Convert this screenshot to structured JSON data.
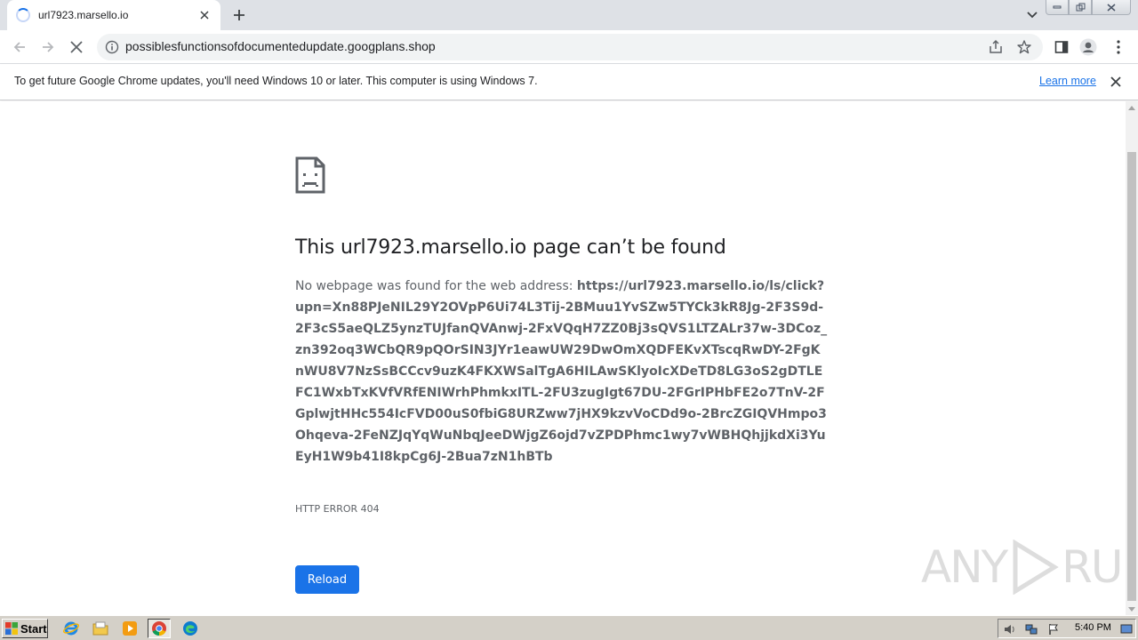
{
  "browser": {
    "tab": {
      "title": "url7923.marsello.io"
    },
    "omnibox": {
      "url": "possiblesfunctionsofdocumentedupdate.googplans.shop"
    }
  },
  "infobar": {
    "message": "To get future Google Chrome updates, you'll need Windows 10 or later. This computer is using Windows 7.",
    "learn_more": "Learn more"
  },
  "error_page": {
    "title": "This url7923.marsello.io page can’t be found",
    "description_prefix": "No webpage was found for the web address: ",
    "address": "https://url7923.marsello.io/ls/click?upn=Xn88PJeNIL29Y2OVpP6Ui74L3Tij-2BMuu1YvSZw5TYCk3kR8Jg-2F3S9d-2F3cS5aeQLZ5ynzTUJfanQVAnwj-2FxVQqH7ZZ0Bj3sQVS1LTZALr37w-3DCoz_zn392oq3WCbQR9pQOrSIN3JYr1eawUW29DwOmXQDFEKvXTscqRwDY-2FgKnWU8V7NzSsBCCcv9uzK4FKXWSalTgA6HILAwSKlyoIcXDeTD8LG3oS2gDTLEFC1WxbTxKVfVRfENIWrhPhmkxITL-2FU3zugIgt67DU-2FGrIPHbFE2o7TnV-2FGplwjtHHc554IcFVD00uS0fbiG8URZww7jHX9kzvVoCDd9o-2BrcZGIQVHmpo3Ohqeva-2FeNZJqYqWuNbqJeeDWjgZ6ojd7vZPDPhmc1wy7vWBHQhjjkdXi3YuEyH1W9b41I8kpCg6J-2Bua7zN1hBTb",
    "error_code": "HTTP ERROR 404",
    "reload_label": "Reload"
  },
  "watermark": {
    "left": "ANY",
    "right": "RUN"
  },
  "taskbar": {
    "start_label": "Start",
    "clock": "5:40 PM",
    "apps": [
      "internet-explorer-icon",
      "folder-icon",
      "media-player-icon",
      "chrome-icon",
      "edge-icon"
    ]
  },
  "colors": {
    "accent": "#1a73e8",
    "tabstrip": "#dee1e6",
    "taskbar": "#d4d0c8"
  }
}
